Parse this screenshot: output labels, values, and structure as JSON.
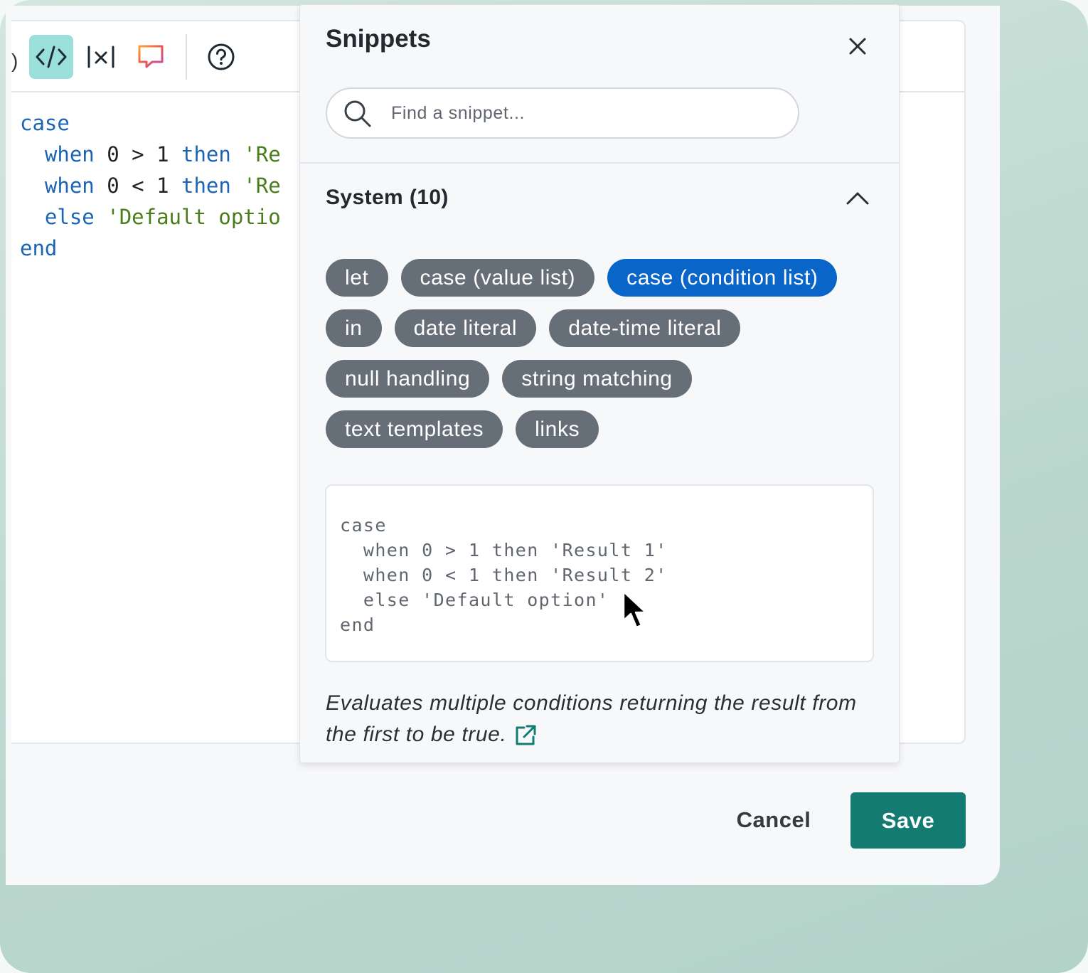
{
  "editor": {
    "toolbar": {
      "partial_glyph": ")",
      "code_icon": "code-icon",
      "variable_icon": "variable-icon",
      "comment_icon": "comment-icon",
      "help_icon": "help-icon"
    },
    "code_lines": [
      [
        {
          "t": "case",
          "c": "kw"
        }
      ],
      [
        {
          "t": "  "
        },
        {
          "t": "when",
          "c": "kw"
        },
        {
          "t": " 0 > 1 "
        },
        {
          "t": "then",
          "c": "kw"
        },
        {
          "t": " "
        },
        {
          "t": "'Re",
          "c": "str"
        }
      ],
      [
        {
          "t": "  "
        },
        {
          "t": "when",
          "c": "kw"
        },
        {
          "t": " 0 < 1 "
        },
        {
          "t": "then",
          "c": "kw"
        },
        {
          "t": " "
        },
        {
          "t": "'Re",
          "c": "str"
        }
      ],
      [
        {
          "t": "  "
        },
        {
          "t": "else",
          "c": "kw"
        },
        {
          "t": " "
        },
        {
          "t": "'Default optio",
          "c": "str"
        }
      ],
      [
        {
          "t": "end",
          "c": "kw"
        }
      ]
    ]
  },
  "snippets_panel": {
    "title": "Snippets",
    "search": {
      "placeholder": "Find a snippet...",
      "value": ""
    },
    "section": {
      "label": "System (10)",
      "expanded": true
    },
    "chips": [
      {
        "label": "let",
        "selected": false
      },
      {
        "label": "case (value list)",
        "selected": false
      },
      {
        "label": "case (condition list)",
        "selected": true
      },
      {
        "label": "in",
        "selected": false
      },
      {
        "label": "date literal",
        "selected": false
      },
      {
        "label": "date-time literal",
        "selected": false
      },
      {
        "label": "null handling",
        "selected": false
      },
      {
        "label": "string matching",
        "selected": false
      },
      {
        "label": "text templates",
        "selected": false
      },
      {
        "label": "links",
        "selected": false
      }
    ],
    "preview_code": "case\n  when 0 > 1 then 'Result 1'\n  when 0 < 1 then 'Result 2'\n  else 'Default option'\nend",
    "description": "Evaluates multiple conditions returning the result from the first to be true."
  },
  "footer": {
    "cancel_label": "Cancel",
    "save_label": "Save"
  },
  "colors": {
    "accent": "#137b72",
    "chip": "#666e78",
    "chip_selected": "#0a65c9",
    "active_tool": "#9adfd9",
    "keyword": "#1b64b5",
    "string": "#4a7d1a"
  }
}
